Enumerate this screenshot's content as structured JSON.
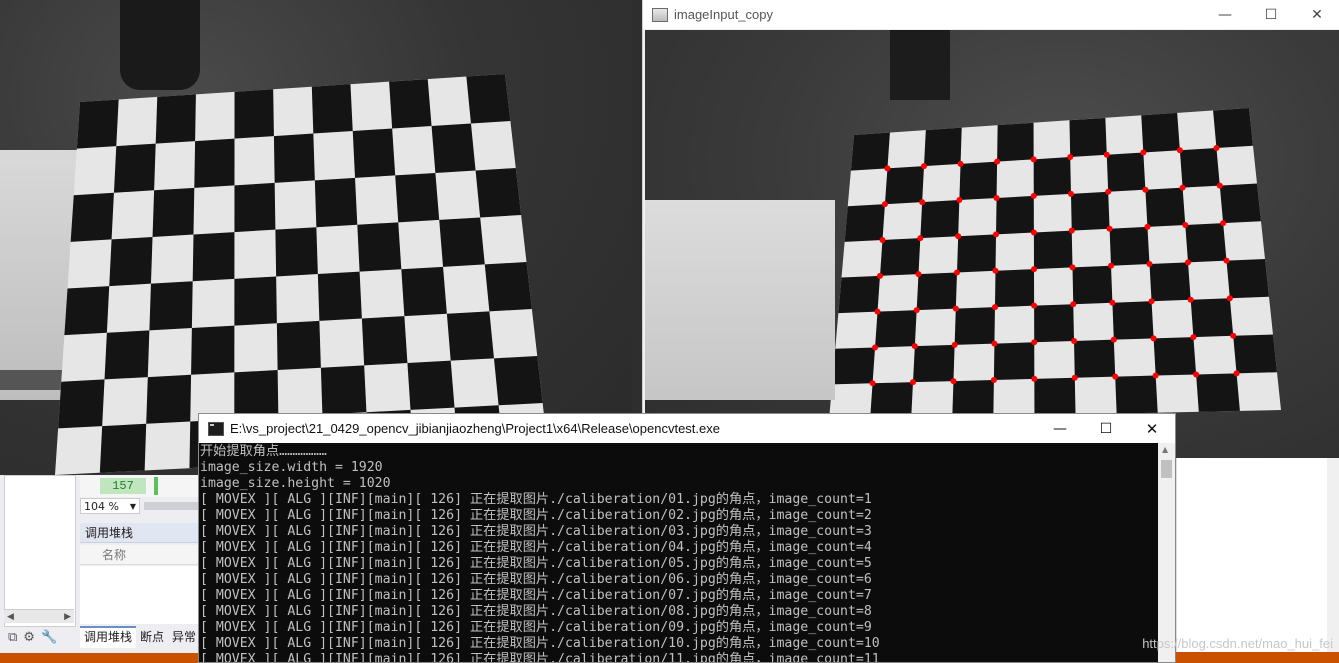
{
  "opencv_window": {
    "title": "imageInput_copy",
    "minimize_glyph": "—",
    "maximize_glyph": "☐",
    "close_glyph": "✕",
    "corner_color": "#ff0000"
  },
  "console_window": {
    "title": "E:\\vs_project\\21_0429_opencv_jibianjiaozheng\\Project1\\x64\\Release\\opencvtest.exe",
    "minimize_glyph": "—",
    "maximize_glyph": "☐",
    "close_glyph": "✕",
    "lines": [
      "开始提取角点………………",
      "image_size.width = 1920",
      "image_size.height = 1020",
      "[ MOVEX ][ ALG ][INF][main][ 126] 正在提取图片./caliberation/01.jpg的角点，image_count=1",
      "[ MOVEX ][ ALG ][INF][main][ 126] 正在提取图片./caliberation/02.jpg的角点，image_count=2",
      "[ MOVEX ][ ALG ][INF][main][ 126] 正在提取图片./caliberation/03.jpg的角点，image_count=3",
      "[ MOVEX ][ ALG ][INF][main][ 126] 正在提取图片./caliberation/04.jpg的角点，image_count=4",
      "[ MOVEX ][ ALG ][INF][main][ 126] 正在提取图片./caliberation/05.jpg的角点，image_count=5",
      "[ MOVEX ][ ALG ][INF][main][ 126] 正在提取图片./caliberation/06.jpg的角点，image_count=6",
      "[ MOVEX ][ ALG ][INF][main][ 126] 正在提取图片./caliberation/07.jpg的角点，image_count=7",
      "[ MOVEX ][ ALG ][INF][main][ 126] 正在提取图片./caliberation/08.jpg的角点，image_count=8",
      "[ MOVEX ][ ALG ][INF][main][ 126] 正在提取图片./caliberation/09.jpg的角点，image_count=9",
      "[ MOVEX ][ ALG ][INF][main][ 126] 正在提取图片./caliberation/10.jpg的角点，image_count=10",
      "[ MOVEX ][ ALG ][INF][main][ 126] 正在提取图片./caliberation/11.jpg的角点，image_count=11"
    ]
  },
  "ide": {
    "line_number": "157",
    "zoom": "104 %",
    "call_stack_title": "调用堆栈",
    "name_column": "名称",
    "tabs": [
      "调用堆栈",
      "断点",
      "异常"
    ]
  },
  "watermark": "https://blog.csdn.net/mao_hui_fei"
}
